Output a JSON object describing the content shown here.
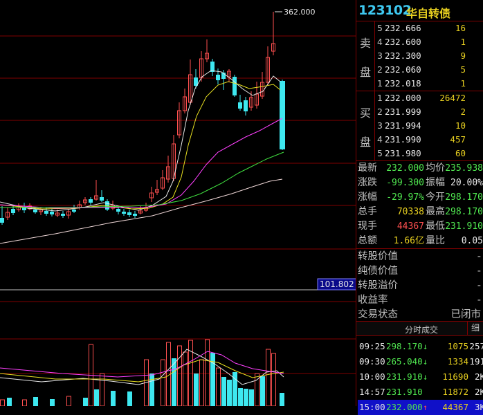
{
  "chart": {
    "high_label": "362.000",
    "price_tag": "101.802"
  },
  "colors": {
    "up": "#ff5050",
    "down": "#3ee8f0",
    "ma5": "#e8e8e8",
    "ma10": "#e8e020",
    "ma20": "#ff40ff",
    "ma60": "#40e040",
    "ma120": "#f0d8d8"
  },
  "header": {
    "code": "123102",
    "name": "华自转债"
  },
  "sell_side_label": [
    "卖",
    "盘"
  ],
  "buy_side_label": [
    "买",
    "盘"
  ],
  "asks": [
    {
      "level": "5",
      "price": "232.666",
      "volume": "16"
    },
    {
      "level": "4",
      "price": "232.600",
      "volume": "1"
    },
    {
      "level": "3",
      "price": "232.300",
      "volume": "9"
    },
    {
      "level": "2",
      "price": "232.060",
      "volume": "5"
    },
    {
      "level": "1",
      "price": "232.018",
      "volume": "1"
    }
  ],
  "bids": [
    {
      "level": "1",
      "price": "232.000",
      "volume": "26472"
    },
    {
      "level": "2",
      "price": "231.999",
      "volume": "2"
    },
    {
      "level": "3",
      "price": "231.994",
      "volume": "10"
    },
    {
      "level": "4",
      "price": "231.990",
      "volume": "457"
    },
    {
      "level": "5",
      "price": "231.980",
      "volume": "60"
    }
  ],
  "stats": [
    {
      "l1": "最新",
      "v1": "232.000",
      "c1": "green",
      "l2": "均价",
      "v2": "235.938",
      "c2": "green"
    },
    {
      "l1": "涨跌",
      "v1": "-99.300",
      "c1": "green",
      "l2": "振幅",
      "v2": "20.00%",
      "c2": "wht"
    },
    {
      "l1": "涨幅",
      "v1": "-29.97%",
      "c1": "green",
      "l2": "今开",
      "v2": "298.170",
      "c2": "green"
    },
    {
      "l1": "总手",
      "v1": "70338",
      "c1": "yel",
      "l2": "最高",
      "v2": "298.170",
      "c2": "green"
    },
    {
      "l1": "现手",
      "v1": "44367",
      "c1": "red",
      "l2": "最低",
      "v2": "231.910",
      "c2": "green"
    },
    {
      "l1": "总额",
      "v1": "1.66亿",
      "c1": "yel",
      "l2": "量比",
      "v2": "0.05",
      "c2": "wht"
    }
  ],
  "valuation": [
    {
      "label": "转股价值",
      "value": "-"
    },
    {
      "label": "纯债价值",
      "value": "-"
    },
    {
      "label": "转股溢价",
      "value": "-"
    },
    {
      "label": "收益率",
      "value": "-"
    },
    {
      "label": "交易状态",
      "value": "已闭市"
    }
  ],
  "ticks_header": {
    "title": "分时成交",
    "detail": "细"
  },
  "ticks": [
    {
      "time": "09:25",
      "price": "298.170",
      "arrow": "↓",
      "vol": "1075",
      "num": "257",
      "pc": "green",
      "ac": "green"
    },
    {
      "time": "09:30",
      "price": "265.040",
      "arrow": "↓",
      "vol": "1334",
      "num": "191",
      "pc": "green",
      "ac": "green"
    },
    {
      "time": "10:00",
      "price": "231.910",
      "arrow": "↓",
      "vol": "11690",
      "num": "2K",
      "pc": "green",
      "ac": "green"
    },
    {
      "time": "14:57",
      "price": "231.910",
      "arrow": "",
      "vol": "11872",
      "num": "2K",
      "pc": "green",
      "ac": "green"
    },
    {
      "time": "15:00",
      "price": "232.000",
      "arrow": "↑",
      "vol": "44367",
      "num": "3K",
      "pc": "green",
      "ac": "red"
    }
  ]
}
